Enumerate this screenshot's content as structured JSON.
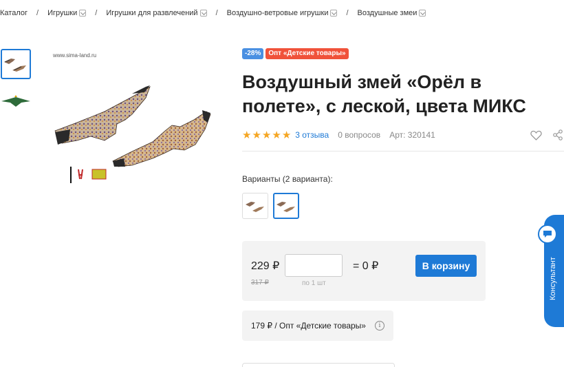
{
  "breadcrumb": {
    "items": [
      {
        "label": "Каталог",
        "dropdown": false
      },
      {
        "label": "Игрушки",
        "dropdown": true
      },
      {
        "label": "Игрушки для развлечений",
        "dropdown": true
      },
      {
        "label": "Воздушно-ветровые игрушки",
        "dropdown": true
      },
      {
        "label": "Воздушные змеи",
        "dropdown": true
      }
    ],
    "separator": "/"
  },
  "gallery": {
    "watermark": "www.sima-land.ru",
    "thumbnails": [
      "kite-pair-photo",
      "kite-green-photo"
    ],
    "active_thumbnail": 0
  },
  "product": {
    "badges": {
      "discount": "-28%",
      "opt": "Опт «Детские товары»"
    },
    "title": "Воздушный змей «Орёл в полете», с леской, цвета МИКС",
    "rating": 5,
    "reviews": "3 отзыва",
    "questions": "0 вопросов",
    "article": "Арт: 320141"
  },
  "variants": {
    "label": "Варианты (2 варианта):",
    "selected": 1
  },
  "price": {
    "current": "229 ₽",
    "old": "317 ₽",
    "quantity_value": "",
    "quantity_hint": "по 1 шт",
    "total": "= 0 ₽",
    "cart_button": "В корзину"
  },
  "wholesale": {
    "text": "179 ₽ / Опт «Детские товары»"
  },
  "consultant": {
    "label": "Консультант"
  },
  "colors": {
    "accent": "#1e7ad6",
    "discount": "#4a90e2",
    "opt_badge": "#f0523a",
    "star": "#f5a623"
  }
}
